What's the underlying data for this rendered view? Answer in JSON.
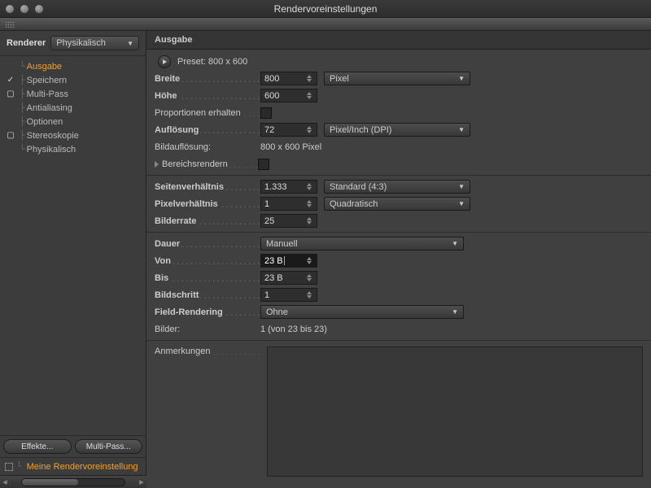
{
  "window": {
    "title": "Rendervoreinstellungen"
  },
  "sidebar": {
    "renderer_label": "Renderer",
    "renderer_value": "Physikalisch",
    "items": [
      {
        "label": "Ausgabe",
        "active": true,
        "check": ""
      },
      {
        "label": "Speichern",
        "active": false,
        "check": "✓"
      },
      {
        "label": "Multi-Pass",
        "active": false,
        "check": "□"
      },
      {
        "label": "Antialiasing",
        "active": false,
        "check": ""
      },
      {
        "label": "Optionen",
        "active": false,
        "check": ""
      },
      {
        "label": "Stereoskopie",
        "active": false,
        "check": "□"
      },
      {
        "label": "Physikalisch",
        "active": false,
        "check": ""
      }
    ],
    "btn_effects": "Effekte...",
    "btn_multipass": "Multi-Pass...",
    "my_render": "Meine Rendervoreinstellung"
  },
  "panel": {
    "title": "Ausgabe",
    "preset_label": "Preset: 800 x 600",
    "width_label": "Breite",
    "width_value": "800",
    "height_label": "Höhe",
    "height_value": "600",
    "unit_pixel": "Pixel",
    "lock_label": "Proportionen erhalten",
    "res_label": "Auflösung",
    "res_value": "72",
    "res_unit": "Pixel/Inch (DPI)",
    "imgres_label": "Bildauflösung:",
    "imgres_value": "800 x 600 Pixel",
    "region_label": "Bereichsrendern",
    "filmaspect_label": "Seitenverhältnis",
    "filmaspect_value": "1.333",
    "filmaspect_preset": "Standard (4:3)",
    "pixelaspect_label": "Pixelverhältnis",
    "pixelaspect_value": "1",
    "pixelaspect_preset": "Quadratisch",
    "fps_label": "Bilderrate",
    "fps_value": "25",
    "range_label": "Dauer",
    "range_value": "Manuell",
    "from_label": "Von",
    "from_value": "23 B",
    "to_label": "Bis",
    "to_value": "23 B",
    "step_label": "Bildschritt",
    "step_value": "1",
    "field_label": "Field-Rendering",
    "field_value": "Ohne",
    "frames_label": "Bilder:",
    "frames_value": "1 (von 23 bis 23)",
    "notes_label": "Anmerkungen"
  }
}
